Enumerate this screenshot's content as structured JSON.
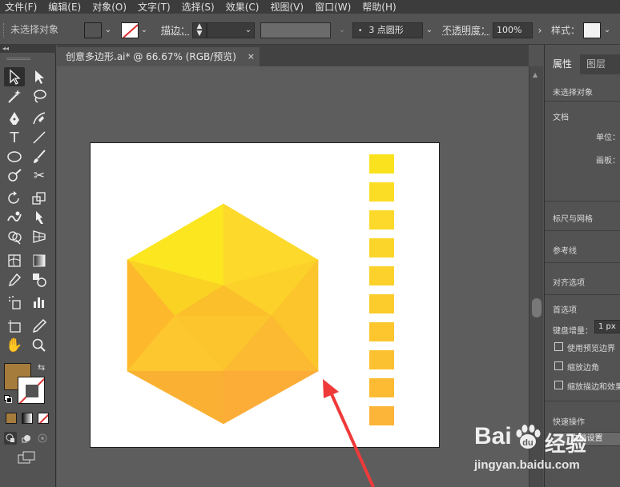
{
  "menubar": {
    "items": [
      "文件(F)",
      "编辑(E)",
      "对象(O)",
      "文字(T)",
      "选择(S)",
      "效果(C)",
      "视图(V)",
      "窗口(W)",
      "帮助(H)"
    ]
  },
  "controlbar": {
    "selection_label": "未选择对象",
    "fill_color": "#a67c3d",
    "stroke_label": "描边：",
    "brush_label": "3 点圆形",
    "opacity_label": "不透明度：",
    "opacity_value": "100%",
    "style_label": "样式："
  },
  "tools": {
    "collapse_glyph": "◂◂",
    "fill_color": "#a67c3d",
    "stroke_color": "#ffffff"
  },
  "document": {
    "tab_title": "创意多边形.ai* @ 66.67% (RGB/预览)",
    "close_glyph": "×"
  },
  "artwork": {
    "hexagon_colors": [
      "#fbe620",
      "#fcd92b",
      "#f9d224",
      "#fcd12a",
      "#fdb92b",
      "#fbc52b",
      "#fbbf2b",
      "#fcc52d",
      "#fdc72f",
      "#fbba31",
      "#fab133",
      "#fcad38"
    ],
    "swatch_colors": [
      "#fbe21f",
      "#fcdd25",
      "#fcd92a",
      "#fcd52a",
      "#fdd12b",
      "#fccb2c",
      "#fdc62f",
      "#fcc131",
      "#fdbb33",
      "#fcb538"
    ],
    "arrow_color": "#ef3a3a"
  },
  "right_panel": {
    "tab_properties": "属性",
    "tab_layers": "图层",
    "no_selection": "未选择对象",
    "document_label": "文档",
    "unit_label": "单位：",
    "artboard_label": "画板：",
    "rulers_grid": "标尺与网格",
    "guides": "参考线",
    "align_options": "对齐选项",
    "preferences": "首选项",
    "keyboard_increment_label": "键盘增量：",
    "keyboard_increment_value": "1 px",
    "use_preview_bounds": "使用预览边界",
    "scale_corners": "缩放边角",
    "scale_strokes_effects": "缩放描边和效果",
    "quick_actions": "快速操作",
    "document_setup": "文档设置"
  },
  "watermark": {
    "brand": "Bai",
    "brand_cn": "经验",
    "url": "jingyan.baidu.com"
  }
}
